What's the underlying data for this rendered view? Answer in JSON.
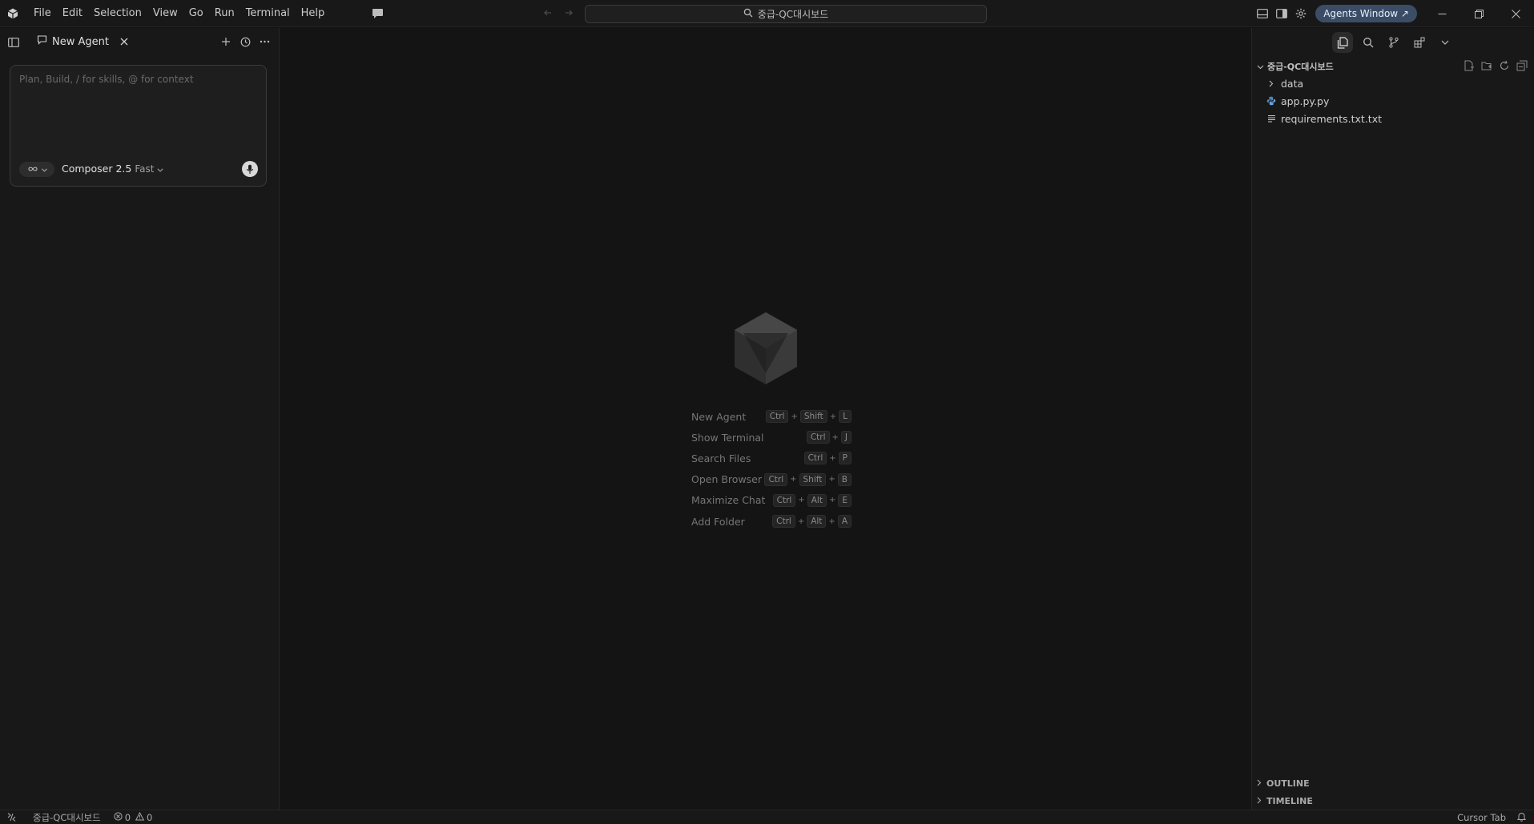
{
  "menu": [
    "File",
    "Edit",
    "Selection",
    "View",
    "Go",
    "Run",
    "Terminal",
    "Help"
  ],
  "search": {
    "text": "중급-QC대시보드"
  },
  "titlebar": {
    "agents_window": "Agents Window ↗"
  },
  "left_panel": {
    "tab_label": "New Agent",
    "composer": {
      "placeholder": "Plan, Build, / for skills, @ for context",
      "model": "Composer 2.5",
      "speed": "Fast"
    }
  },
  "center": {
    "shortcuts": [
      {
        "label": "New Agent",
        "keys": [
          "Ctrl",
          "Shift",
          "L"
        ]
      },
      {
        "label": "Show Terminal",
        "keys": [
          "Ctrl",
          "J"
        ]
      },
      {
        "label": "Search Files",
        "keys": [
          "Ctrl",
          "P"
        ]
      },
      {
        "label": "Open Browser",
        "keys": [
          "Ctrl",
          "Shift",
          "B"
        ]
      },
      {
        "label": "Maximize Chat",
        "keys": [
          "Ctrl",
          "Alt",
          "E"
        ]
      },
      {
        "label": "Add Folder",
        "keys": [
          "Ctrl",
          "Alt",
          "A"
        ]
      }
    ]
  },
  "explorer": {
    "root": "중급-QC대시보드",
    "items": [
      {
        "name": "data",
        "type": "folder"
      },
      {
        "name": "app.py.py",
        "type": "python"
      },
      {
        "name": "requirements.txt.txt",
        "type": "text"
      }
    ],
    "outline": "OUTLINE",
    "timeline": "TIMELINE"
  },
  "statusbar": {
    "folder": "중급-QC대시보드",
    "errors": "0",
    "warnings": "0",
    "cursor_tab": "Cursor Tab"
  },
  "colors": {
    "accent_button": "#3b4d66",
    "background": "#141414",
    "panel": "#181818"
  }
}
